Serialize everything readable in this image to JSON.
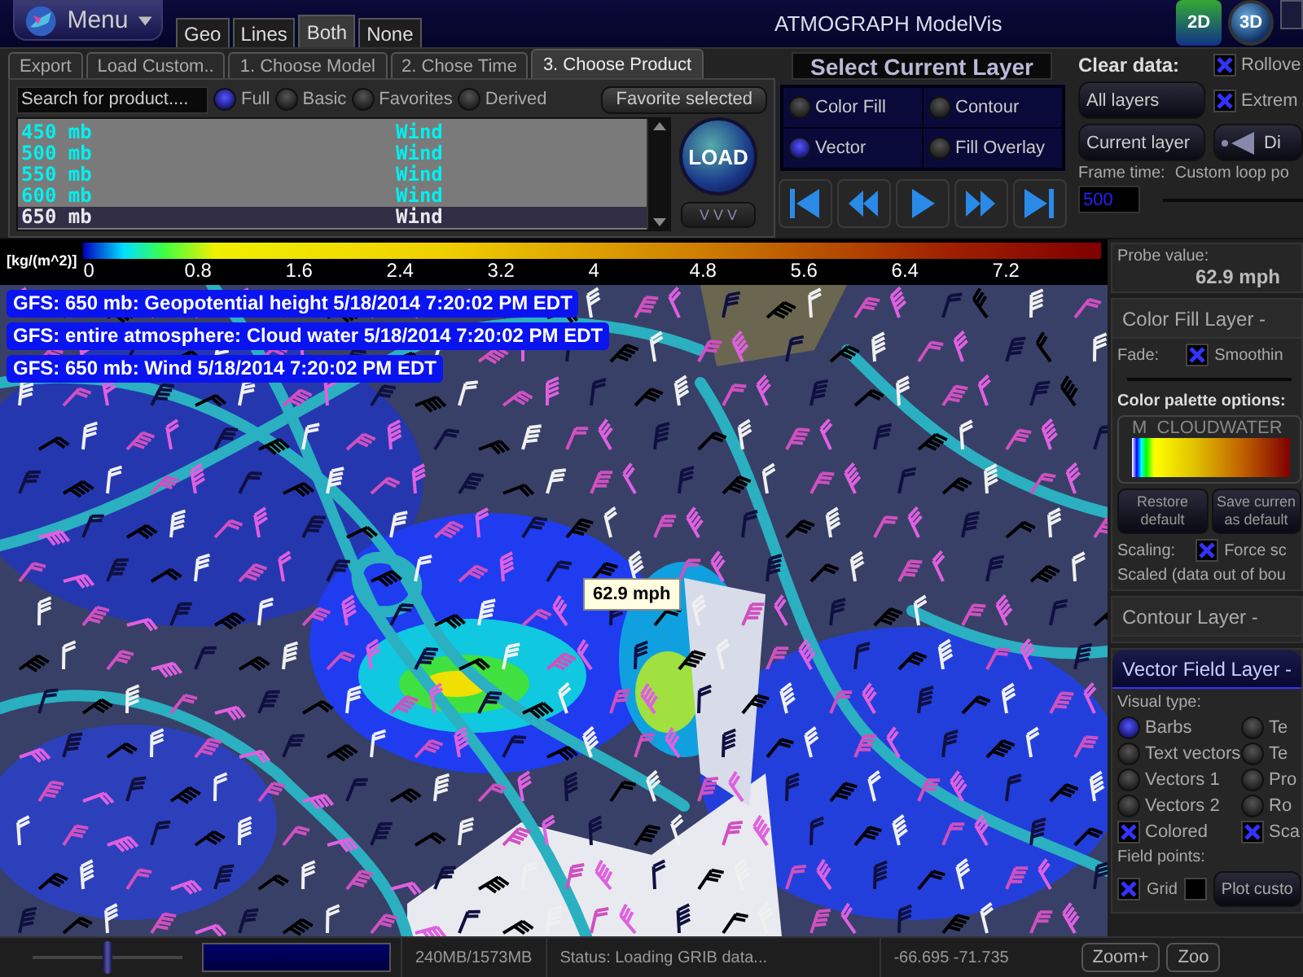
{
  "menu": {
    "label": "Menu"
  },
  "map_tabs": [
    {
      "label": "Geo",
      "selected": false
    },
    {
      "label": "Lines",
      "selected": false
    },
    {
      "label": "Both",
      "selected": true
    },
    {
      "label": "None",
      "selected": false
    }
  ],
  "window": {
    "title": "ATMOGRAPH ModelVis"
  },
  "view_modes": [
    {
      "label": "2D",
      "selected": false
    },
    {
      "label": "3D",
      "selected": true
    }
  ],
  "product_tabs": [
    {
      "label": "Export",
      "selected": false
    },
    {
      "label": "Load Custom..",
      "selected": false
    },
    {
      "label": "1. Choose Model",
      "selected": false
    },
    {
      "label": "2. Chose Time",
      "selected": false
    },
    {
      "label": "3. Choose Product",
      "selected": true
    }
  ],
  "search": {
    "placeholder": "Search for product...."
  },
  "filters": [
    {
      "label": "Full",
      "selected": true
    },
    {
      "label": "Basic",
      "selected": false
    },
    {
      "label": "Favorites",
      "selected": false
    },
    {
      "label": "Derived",
      "selected": false
    }
  ],
  "favorite_button": "Favorite selected",
  "products": [
    {
      "pressure": "450 mb",
      "name": "Wind",
      "selected": false
    },
    {
      "pressure": "500 mb",
      "name": "Wind",
      "selected": false
    },
    {
      "pressure": "550 mb",
      "name": "Wind",
      "selected": false
    },
    {
      "pressure": "600 mb",
      "name": "Wind",
      "selected": false
    },
    {
      "pressure": "650 mb",
      "name": "Wind",
      "selected": true
    }
  ],
  "load_button": "LOAD",
  "expand_button": "V V V",
  "layer_select": {
    "title": "Select Current Layer",
    "options": [
      {
        "label": "Color Fill",
        "selected": false
      },
      {
        "label": "Contour",
        "selected": false
      },
      {
        "label": "Vector",
        "selected": true
      },
      {
        "label": "Fill Overlay",
        "selected": false
      }
    ]
  },
  "clear_data": {
    "title": "Clear data:",
    "buttons": [
      "All layers",
      "Current layer"
    ]
  },
  "options": [
    {
      "label": "Rollove",
      "checked": true
    },
    {
      "label": "Extrem",
      "checked": true
    }
  ],
  "display_button": "Di",
  "frame_time": {
    "label": "Frame time:",
    "value": "500"
  },
  "custom_loop": {
    "label": "Custom loop po"
  },
  "colorbar": {
    "unit": "[kg/(m^2)]",
    "ticks": [
      "0",
      "0.8",
      "1.6",
      "2.4",
      "3.2",
      "4",
      "4.8",
      "5.6",
      "6.4",
      "7.2"
    ]
  },
  "map": {
    "layers": [
      "GFS: 650 mb: Geopotential height 5/18/2014 7:20:02 PM EDT",
      "GFS: entire atmosphere: Cloud water 5/18/2014 7:20:02 PM EDT",
      "GFS: 650 mb: Wind 5/18/2014 7:20:02 PM EDT"
    ],
    "probe": "62.9 mph"
  },
  "probe": {
    "label": "Probe value:",
    "value": "62.9 mph"
  },
  "color_fill_layer": {
    "title": "Color Fill Layer -",
    "fade_label": "Fade:",
    "smoothing": {
      "label": "Smoothin",
      "checked": true
    },
    "palette_label": "Color palette options:",
    "palette_name": "M  CLOUDWATER",
    "buttons": [
      "Restore\ndefault",
      "Save curren\nas default"
    ],
    "scaling_label": "Scaling:",
    "force_scale": {
      "label": "Force sc",
      "checked": true
    },
    "note": "Scaled (data out of bou"
  },
  "contour_layer": {
    "title": "Contour Layer -"
  },
  "vector_layer": {
    "title": "Vector Field Layer -",
    "visual_type_label": "Visual type:",
    "visual_types": [
      {
        "kind": "radio",
        "label": "Barbs",
        "selected": true
      },
      {
        "kind": "radio",
        "label": "Te",
        "selected": false
      },
      {
        "kind": "radio",
        "label": "Text vectors",
        "selected": false
      },
      {
        "kind": "radio",
        "label": "Te",
        "selected": false
      },
      {
        "kind": "radio",
        "label": "Vectors 1",
        "selected": false
      },
      {
        "kind": "radio",
        "label": "Pro",
        "selected": false
      },
      {
        "kind": "radio",
        "label": "Vectors 2",
        "selected": false
      },
      {
        "kind": "radio",
        "label": "Ro",
        "selected": false
      },
      {
        "kind": "checkbox",
        "label": "Colored",
        "checked": true
      },
      {
        "kind": "checkbox",
        "label": "Sca",
        "checked": true
      }
    ],
    "field_points_label": "Field points:",
    "grid": {
      "label": "Grid",
      "checked": true
    },
    "custom_points": {
      "checked": false
    },
    "plot_button": "Plot custo"
  },
  "status_bar": {
    "zoom_slider": {
      "level": 0.5
    },
    "progress": {
      "level": 1
    },
    "memory": "240MB/1573MB",
    "status": "Status: Loading GRIB data...",
    "coordinates": "-66.695 -71.735",
    "buttons": [
      "Zoom+",
      "Zoo"
    ]
  }
}
